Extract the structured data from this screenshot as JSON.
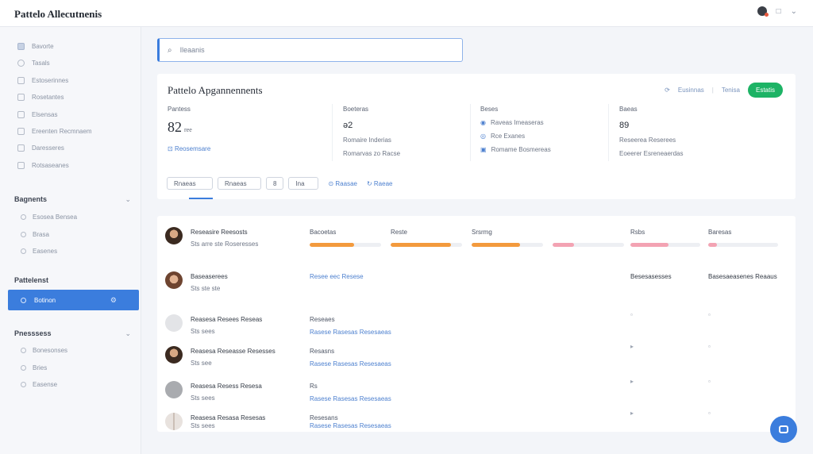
{
  "app": {
    "title": "Pattelo Allecutnenis"
  },
  "topbar": {
    "icons": [
      "user-avatar",
      "window-icon",
      "chevron-down-icon"
    ],
    "icon_glyphs": [
      "□",
      "⌄"
    ]
  },
  "sidebar": {
    "items": [
      {
        "label": "Bavorte",
        "icon": "home-icon"
      },
      {
        "label": "Tasals",
        "icon": "circle-icon"
      },
      {
        "label": "Estoserinnes",
        "icon": "folder-icon"
      },
      {
        "label": "Rosetantes",
        "icon": "document-icon"
      },
      {
        "label": "Elsensas",
        "icon": "list-icon"
      },
      {
        "label": "Ereenten Recmnaem",
        "icon": "calendar-icon"
      },
      {
        "label": "Daresseres",
        "icon": "clock-icon"
      },
      {
        "label": "Rotsaseanes",
        "icon": "box-icon"
      }
    ],
    "sections": [
      {
        "title": "Bagnents",
        "items": [
          "Esosea Bensea",
          "Brasa",
          "Easenes"
        ]
      },
      {
        "title": "Pattelenst",
        "active": "Botinon"
      },
      {
        "title": "Pnesssess",
        "items": [
          "Bonesonses",
          "Bries",
          "Easense"
        ]
      }
    ]
  },
  "search": {
    "icon_glyph": "⌕",
    "value": "Ileaanis"
  },
  "summary": {
    "title": "Pattelo Apgannennents",
    "actions": [
      "Eusinnas",
      "Tenisa"
    ],
    "primary": "Estatis",
    "stats": [
      {
        "label": "Pantess",
        "big": "82",
        "big_unit": "ree",
        "link": "Reosemsare"
      },
      {
        "label": "Boeteras",
        "mid": "ə2",
        "sub1": "Romaire Inderias",
        "sub2": "Romarvas zo Racse"
      },
      {
        "label": "Beses",
        "rows": [
          "Raveas Imeaseras",
          "Rce Exanes",
          "Romame Bosmereas"
        ]
      },
      {
        "label": "Baeas",
        "mid": "89",
        "sub1": "Reseerea Reserees",
        "sub2": "Eoeerer Esreneaerdas"
      }
    ],
    "filters": [
      "Rnaeas",
      "Rnaeas",
      "8",
      "Ina"
    ],
    "filter_links": [
      "Raasae",
      "Raeae"
    ]
  },
  "table": {
    "columns": [
      "Bacoetas",
      "Reste",
      "Srsrmg",
      "",
      "Rsbs",
      "Baresas"
    ],
    "rows": [
      {
        "avatar": "dark",
        "name": "Reseasire Reesosts",
        "sub": "Sts arre ste Roseresses",
        "progress": [
          0.62,
          0.84,
          0.68,
          0.3,
          0.55,
          0.12
        ]
      },
      {
        "avatar": "warm",
        "name": "Baseaserees",
        "sub": "Sts ste ste",
        "link": "Resee eec Resese",
        "c5": "Besesasesses",
        "c6": "Basesaeasenes Reaaus"
      },
      {
        "avatar": "light",
        "name": "Reasesa Resees Reseas",
        "sub": "Sts sees",
        "c1": "Reseaes",
        "c1b": "Rasese Rasesas Resesaeas",
        "mark5": "▫",
        "mark6": "▫"
      },
      {
        "avatar": "dark",
        "name": "Reasesa Reseasse Resesses",
        "sub": "Sts see",
        "c1": "Resasns",
        "c1b": "Rasese Rasesas Resesaeas",
        "mark5": "▸",
        "mark6": "▫"
      },
      {
        "avatar": "grey",
        "name": "Reasesa Resess Resesa",
        "sub": "Sts sees",
        "c1": "Rs",
        "c1b": "Rasese Rasesas Resesaeas",
        "mark5": "▸",
        "mark6": "▫"
      },
      {
        "avatar": "pale",
        "name": "Reasesa Resasa Resesas",
        "sub": "Sts sees",
        "c1": "Resesans",
        "c1b": "Rasese Rasesas Resesaeas",
        "mark5": "▸",
        "mark6": "▫"
      }
    ]
  },
  "colors": {
    "accent": "#3b7ddd",
    "green": "#1db365",
    "orange": "#f39a3d",
    "pink": "#f3a3b3"
  }
}
